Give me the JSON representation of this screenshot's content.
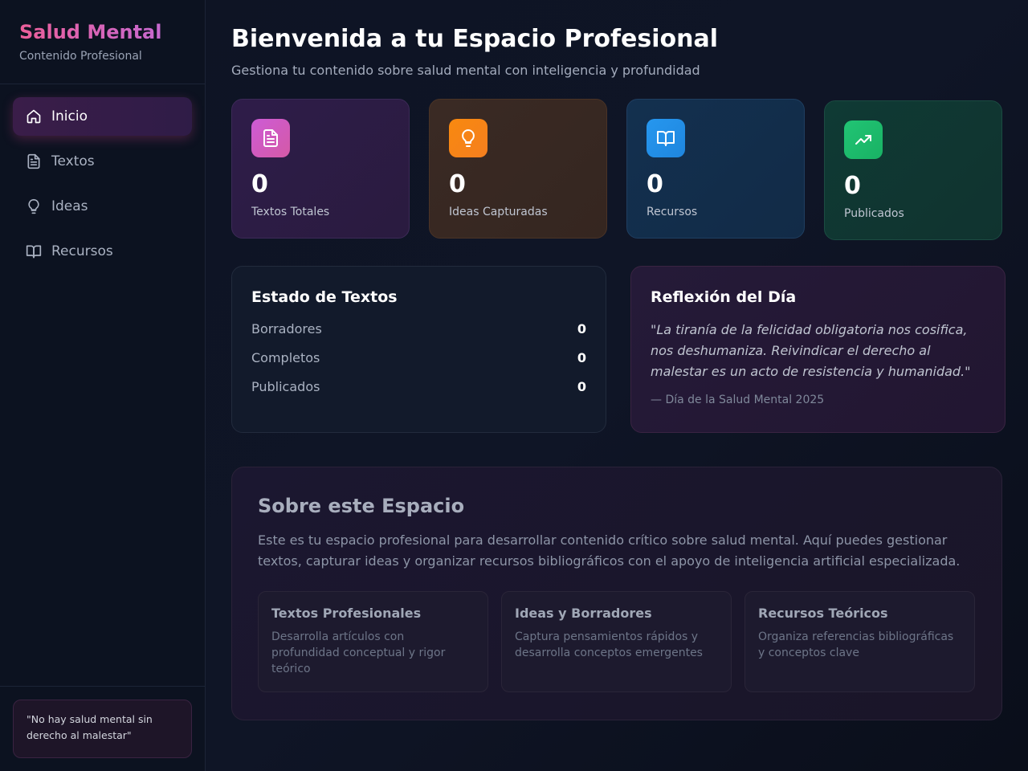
{
  "sidebar": {
    "brand_title": "Salud Mental",
    "brand_subtitle": "Contenido Profesional",
    "items": [
      {
        "label": "Inicio",
        "icon": "home-icon",
        "active": true
      },
      {
        "label": "Textos",
        "icon": "file-text-icon",
        "active": false
      },
      {
        "label": "Ideas",
        "icon": "lightbulb-icon",
        "active": false
      },
      {
        "label": "Recursos",
        "icon": "book-open-icon",
        "active": false
      }
    ],
    "footer_quote": "\"No hay salud mental sin derecho al malestar\""
  },
  "header": {
    "title": "Bienvenida a tu Espacio Profesional",
    "subtitle": "Gestiona tu contenido sobre salud mental con inteligencia y profundidad"
  },
  "stats": [
    {
      "value": "0",
      "label": "Textos Totales",
      "icon": "file-text-icon",
      "color": "#d35bc0"
    },
    {
      "value": "0",
      "label": "Ideas Capturadas",
      "icon": "lightbulb-icon",
      "color": "#f7870f"
    },
    {
      "value": "0",
      "label": "Recursos",
      "icon": "book-open-icon",
      "color": "#2594ea"
    },
    {
      "value": "0",
      "label": "Publicados",
      "icon": "trending-up-icon",
      "color": "#20c06f"
    }
  ],
  "estado": {
    "title": "Estado de Textos",
    "rows": [
      {
        "label": "Borradores",
        "value": "0"
      },
      {
        "label": "Completos",
        "value": "0"
      },
      {
        "label": "Publicados",
        "value": "0"
      }
    ]
  },
  "reflexion": {
    "title": "Reflexión del Día",
    "quote": "\"La tiranía de la felicidad obligatoria nos cosifica, nos deshumaniza. Reivindicar el derecho al malestar es un acto de resistencia y humanidad.\"",
    "source": "— Día de la Salud Mental 2025"
  },
  "about": {
    "title": "Sobre este Espacio",
    "text": "Este es tu espacio profesional para desarrollar contenido crítico sobre salud mental. Aquí puedes gestionar textos, capturar ideas y organizar recursos bibliográficos con el apoyo de inteligencia artificial especializada.",
    "features": [
      {
        "title": "Textos Profesionales",
        "desc": "Desarrolla artículos con profundidad conceptual y rigor teórico"
      },
      {
        "title": "Ideas y Borradores",
        "desc": "Captura pensamientos rápidos y desarrolla conceptos emergentes"
      },
      {
        "title": "Recursos Teóricos",
        "desc": "Organiza referencias bibliográficas y conceptos clave"
      }
    ]
  }
}
